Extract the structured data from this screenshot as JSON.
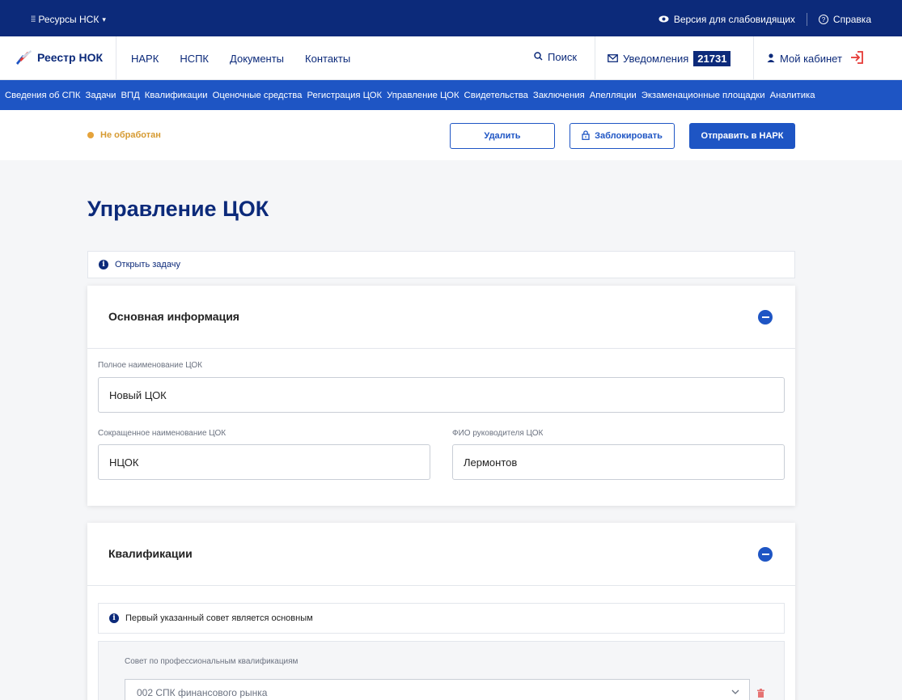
{
  "topbar": {
    "resources_label": "Ресурсы НСК",
    "accessibility_label": "Версия для слабовидящих",
    "help_label": "Справка"
  },
  "header": {
    "logo_text": "Реестр НОК",
    "nav": [
      "НАРК",
      "НСПК",
      "Документы",
      "Контакты"
    ],
    "search_label": "Поиск",
    "notifications_label": "Уведомления",
    "notifications_count": "21731",
    "cabinet_label": "Мой кабинет"
  },
  "menu": {
    "items": [
      "Сведения об СПК",
      "Задачи",
      "ВПД",
      "Квалификации",
      "Оценочные средства",
      "Регистрация ЦОК",
      "Управление ЦОК",
      "Свидетельства",
      "Заключения",
      "Апелляции",
      "Экзаменационные площадки",
      "Аналитика"
    ]
  },
  "status": {
    "label": "Не обработан",
    "color": "#e5a33b"
  },
  "actions": {
    "delete_label": "Удалить",
    "block_label": "Заблокировать",
    "send_label": "Отправить в НАРК"
  },
  "page": {
    "title": "Управление ЦОК",
    "open_task_label": "Открыть задачу"
  },
  "basic_info": {
    "title": "Основная информация",
    "full_name_label": "Полное наименование ЦОК",
    "full_name_value": "Новый ЦОК",
    "short_name_label": "Сокращенное наименование ЦОК",
    "short_name_value": "НЦОК",
    "head_label": "ФИО руководителя ЦОК",
    "head_value": "Лермонтов"
  },
  "qualifications": {
    "title": "Квалификации",
    "notice": "Первый указанный совет является основным",
    "council_label": "Совет по профессиональным квалификациям",
    "council_value": "002 СПК финансового рынка"
  },
  "colors": {
    "brand_dark": "#0c2a7a",
    "brand_blue": "#1e55c4",
    "accent_red": "#e53935"
  }
}
